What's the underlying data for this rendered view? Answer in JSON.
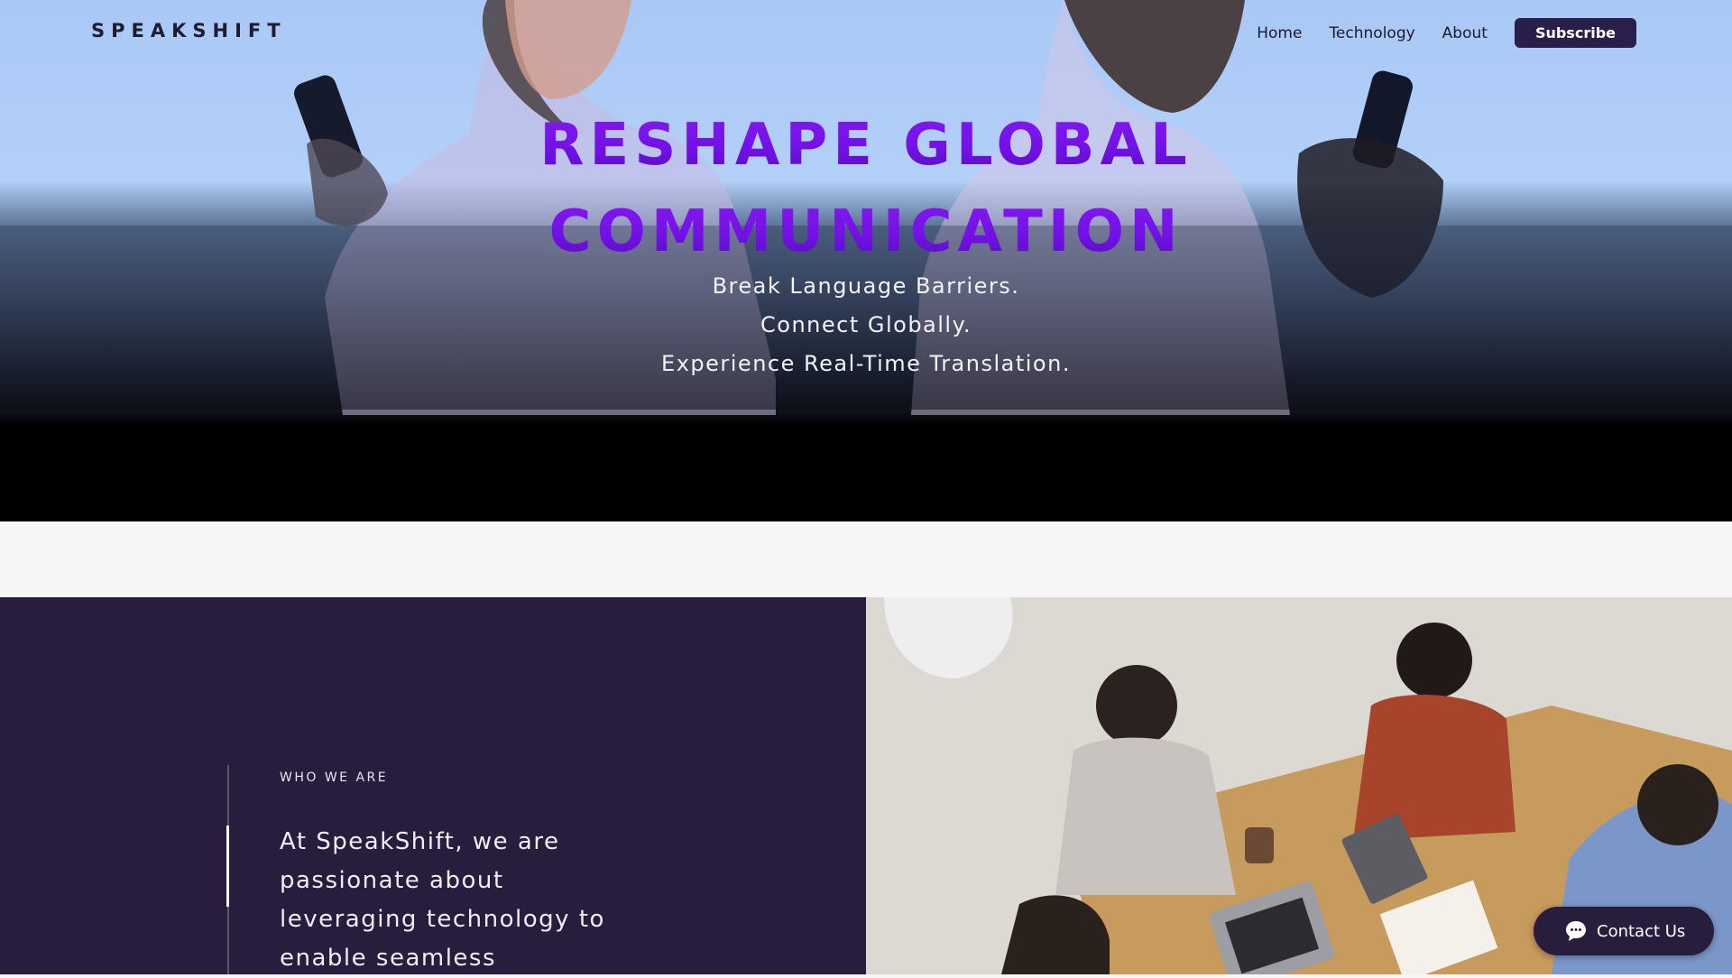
{
  "header": {
    "brand": "SPEAKSHIFT",
    "nav": {
      "home": "Home",
      "technology": "Technology",
      "about": "About",
      "subscribe": "Subscribe"
    }
  },
  "hero": {
    "title_line1": "RESHAPE GLOBAL",
    "title_line2": "COMMUNICATION",
    "sub_line1": "Break Language Barriers.",
    "sub_line2": "Connect Globally.",
    "sub_line3": "Experience Real-Time Translation."
  },
  "who": {
    "kicker": "WHO WE ARE",
    "text": "At SpeakShift, we are passionate about leveraging technology to enable seamless"
  },
  "contact": {
    "label": "Contact Us",
    "icon": "chat-bubble-icon"
  },
  "colors": {
    "accent": "#7a12ea",
    "dark_panel": "#281d3c",
    "subscribe_bg": "#2a1f4a"
  }
}
